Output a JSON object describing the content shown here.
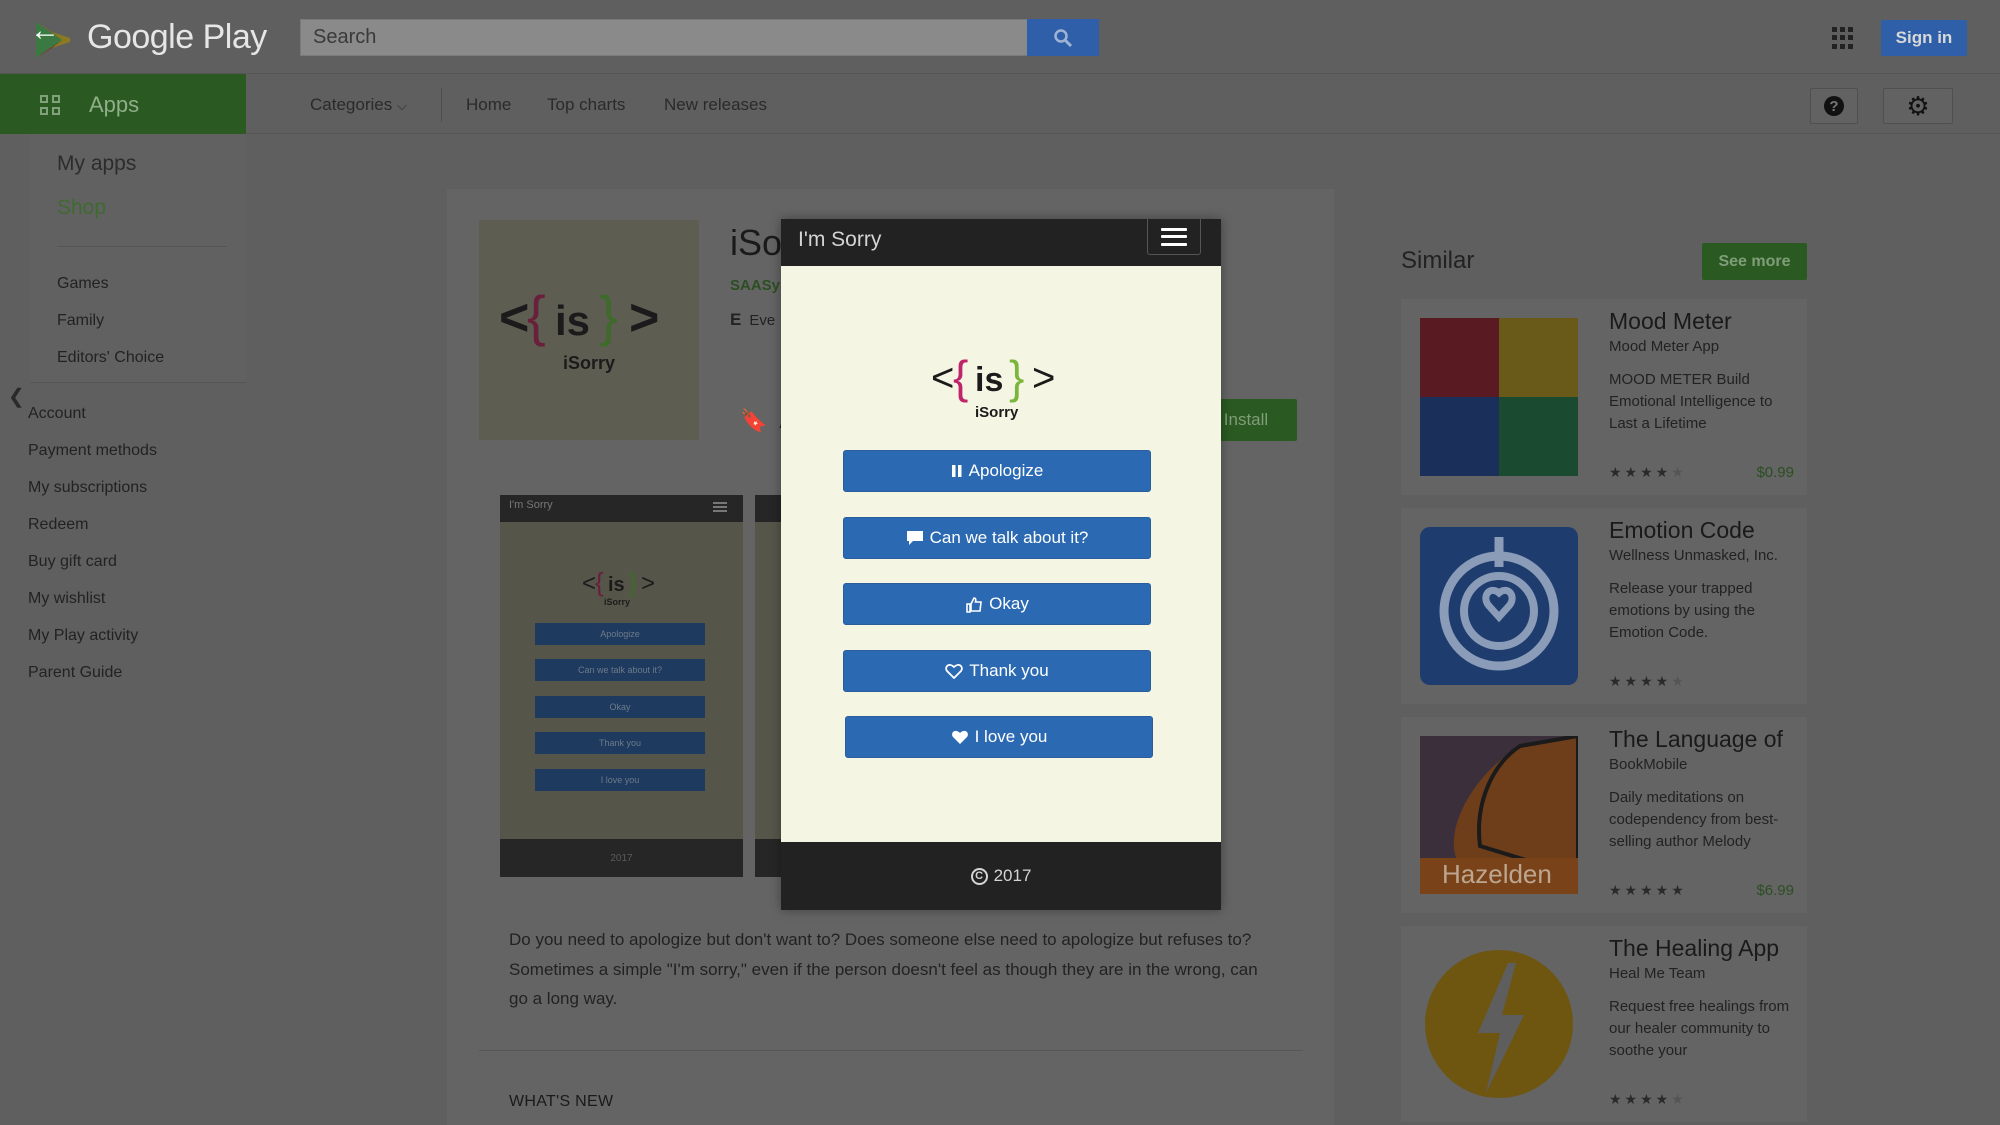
{
  "header": {
    "brand": "Google Play",
    "search_placeholder": "Search",
    "sign_in": "Sign in"
  },
  "nav": {
    "apps_tab": "Apps",
    "categories": "Categories",
    "home": "Home",
    "top_charts": "Top charts",
    "new_releases": "New releases"
  },
  "sidebar": {
    "my_apps": "My apps",
    "shop": "Shop",
    "sections": [
      "Games",
      "Family",
      "Editors' Choice"
    ],
    "account_links": [
      "Account",
      "Payment methods",
      "My subscriptions",
      "Redeem",
      "Buy gift card",
      "My wishlist",
      "My Play activity",
      "Parent Guide"
    ]
  },
  "app": {
    "title_partial": "iSo",
    "developer_partial": "SAASy",
    "rating_partial": "Eve",
    "wishlist_partial": "A",
    "install": "Install",
    "logo_text": "iSorry",
    "description": "Do you need to apologize but don't want to? Does someone else need to apologize but refuses to? Sometimes a simple \"I'm sorry,\" even if the person doesn't feel as though they are in the wrong, can go a long way.",
    "whats_new": "WHAT'S NEW",
    "screenshot1": {
      "title": "I'm Sorry",
      "buttons": [
        "Apologize",
        "Can we talk about it?",
        "Okay",
        "Thank you",
        "I love you"
      ],
      "footer": "2017"
    }
  },
  "modal": {
    "title": "I'm Sorry",
    "logo_text": "iSorry",
    "buttons": [
      {
        "label": "Apologize",
        "icon": "pause-icon"
      },
      {
        "label": "Can we talk about it?",
        "icon": "comment-icon"
      },
      {
        "label": "Okay",
        "icon": "thumbs-up-icon"
      },
      {
        "label": "Thank you",
        "icon": "heart-outline-icon"
      },
      {
        "label": "I love you",
        "icon": "heart-icon"
      }
    ],
    "footer": "2017"
  },
  "similar": {
    "title": "Similar",
    "see_more": "See more",
    "items": [
      {
        "name": "Mood Meter",
        "developer": "Mood Meter App",
        "description": "MOOD METER Build Emotional Intelligence to Last a Lifetime",
        "rating": 3.5,
        "price": "$0.99"
      },
      {
        "name": "Emotion Code",
        "developer": "Wellness Unmasked, Inc.",
        "description": "Release your trapped emotions by using the Emotion Code.",
        "rating": 4,
        "price": ""
      },
      {
        "name": "The Language of",
        "developer": "BookMobile",
        "description": "Daily meditations on codependency from best-selling author Melody",
        "rating": 5,
        "price": "$6.99",
        "thumb_text": "Hazelden"
      },
      {
        "name": "The Healing App",
        "developer": "Heal Me Team",
        "description": "Request free healings from our healer community to soothe your",
        "rating": 4.5,
        "price": ""
      }
    ]
  },
  "colors": {
    "play_green": "#2a5a21",
    "button_blue": "#2b6ab3",
    "modal_bg": "#f5f5e4",
    "dark_bar": "#222222"
  }
}
